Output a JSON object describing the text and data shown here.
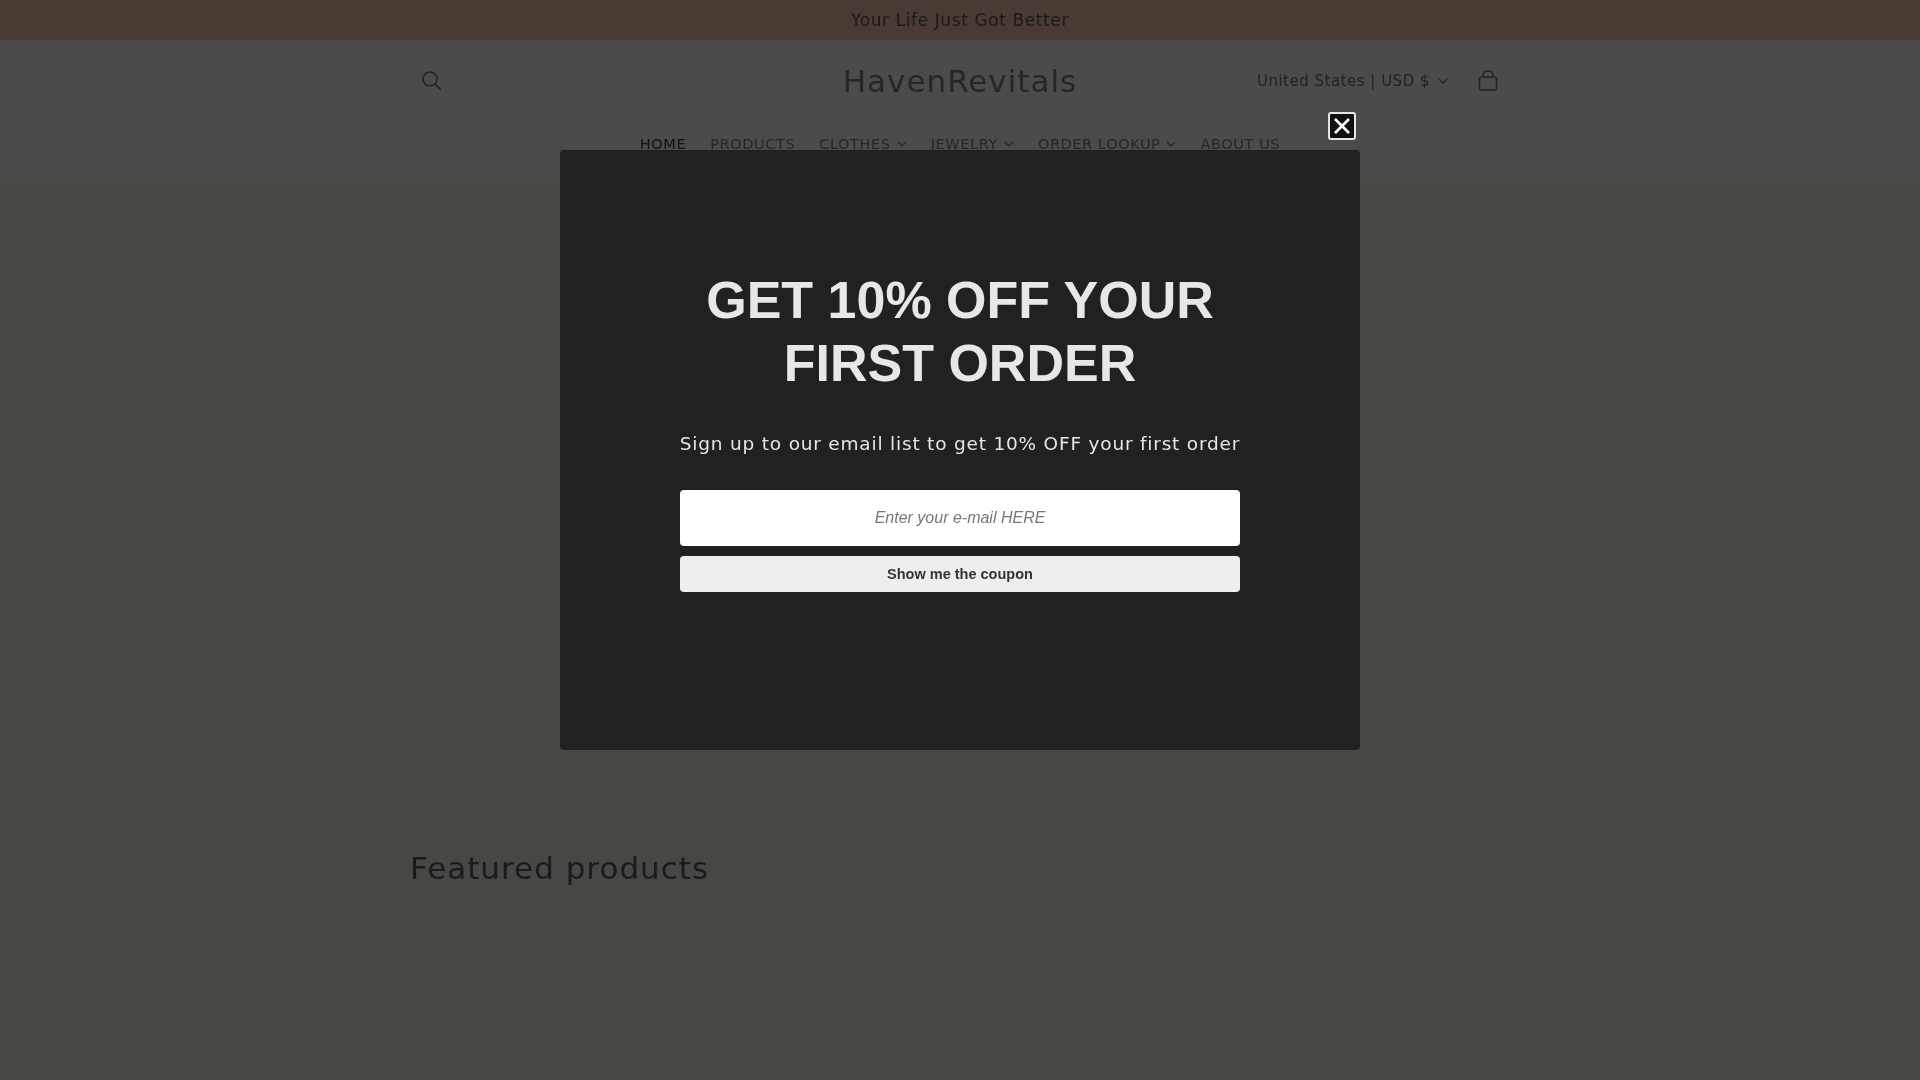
{
  "announcement": "Your Life Just Got Better",
  "header": {
    "logo": "HavenRevitals",
    "currency": "United States | USD $"
  },
  "nav": [
    {
      "label": "HOME",
      "selected": true,
      "dropdown": false
    },
    {
      "label": "PRODUCTS",
      "selected": false,
      "dropdown": false
    },
    {
      "label": "CLOTHES",
      "selected": false,
      "dropdown": true
    },
    {
      "label": "JEWELRY",
      "selected": false,
      "dropdown": true
    },
    {
      "label": "ORDER LOOKUP",
      "selected": false,
      "dropdown": true
    },
    {
      "label": "ABOUT US",
      "selected": false,
      "dropdown": false
    }
  ],
  "popup": {
    "title": "GET 10% OFF YOUR FIRST ORDER",
    "subtitle": "Sign up to our email list to get 10% OFF your first order",
    "email": {
      "placeholder": "Enter your e-mail HERE"
    },
    "button": "Show me the coupon"
  },
  "featured": {
    "title": "Featured products"
  }
}
